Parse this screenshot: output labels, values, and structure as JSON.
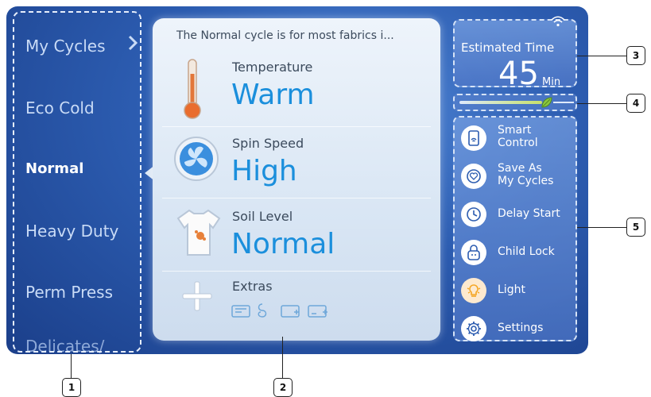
{
  "cycles": {
    "items": [
      {
        "label": "My Cycles"
      },
      {
        "label": "Eco Cold"
      },
      {
        "label": "Normal"
      },
      {
        "label": "Heavy Duty"
      },
      {
        "label": "Perm Press"
      },
      {
        "label": "Delicates/"
      }
    ],
    "selected": "Normal"
  },
  "panel": {
    "description": "The Normal cycle is for most fabrics i...",
    "temperature": {
      "label": "Temperature",
      "value": "Warm"
    },
    "spin": {
      "label": "Spin Speed",
      "value": "High"
    },
    "soil": {
      "label": "Soil Level",
      "value": "Normal"
    },
    "extras": {
      "label": "Extras"
    }
  },
  "time": {
    "label": "Estimated Time",
    "value": "45",
    "unit": "Min"
  },
  "eco_level": 0.72,
  "menu": [
    {
      "label": "Smart\nControl",
      "icon": "smart-control-icon"
    },
    {
      "label": "Save As\nMy Cycles",
      "icon": "save-cycle-icon"
    },
    {
      "label": "Delay Start",
      "icon": "delay-start-icon"
    },
    {
      "label": "Child Lock",
      "icon": "child-lock-icon"
    },
    {
      "label": "Light",
      "icon": "light-icon"
    },
    {
      "label": "Settings",
      "icon": "settings-icon"
    }
  ],
  "callouts": [
    "1",
    "2",
    "3",
    "4",
    "5"
  ],
  "colors": {
    "accent": "#1b8fdc",
    "screen": "#2c5cb0",
    "eco_leaf": "#8cc63f",
    "light": "#f5a623"
  }
}
